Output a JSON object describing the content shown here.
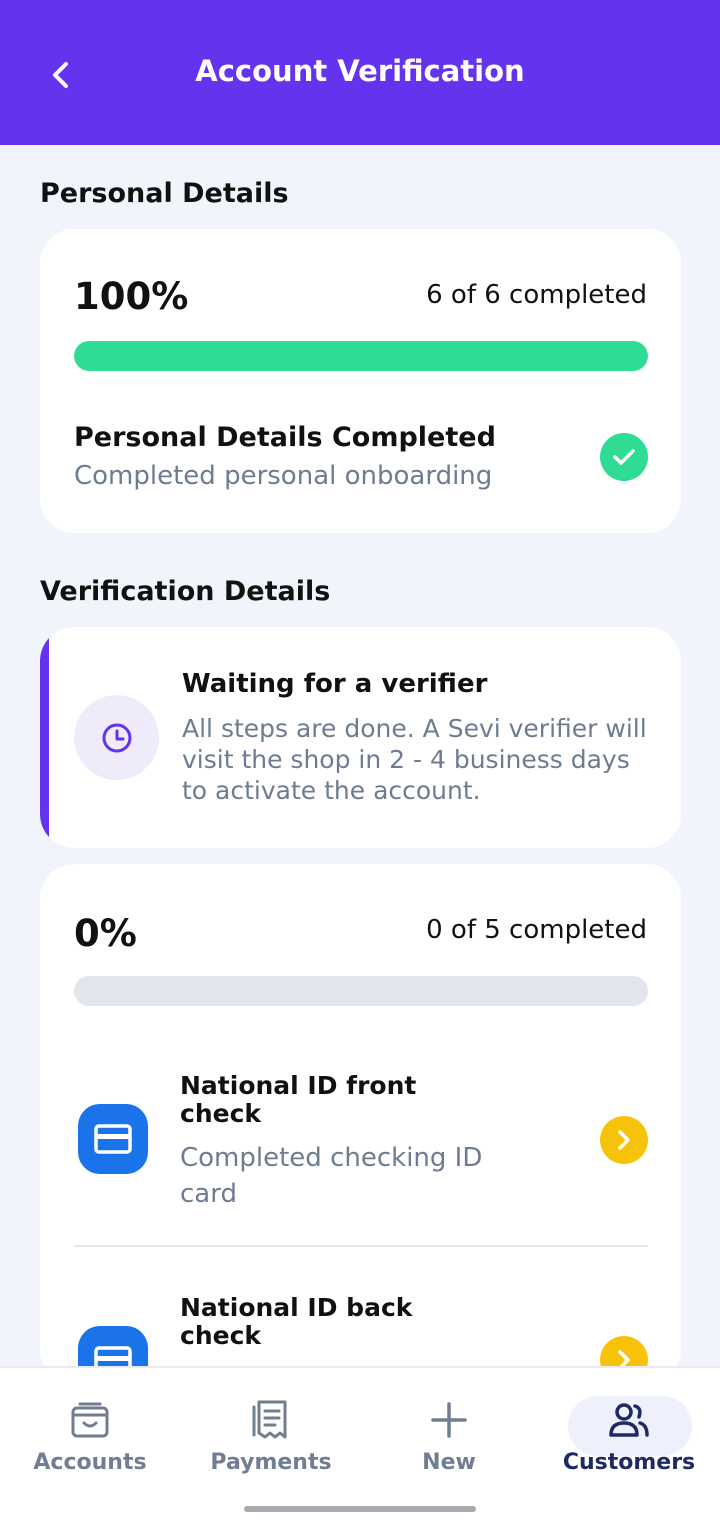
{
  "header": {
    "title": "Account Verification"
  },
  "personal": {
    "section_title": "Personal Details",
    "percent": "100%",
    "progress": 1.0,
    "count": "6 of 6 completed",
    "item_title": "Personal Details Completed",
    "item_subtitle": "Completed personal onboarding"
  },
  "verification": {
    "section_title": "Verification Details",
    "notice_title": "Waiting for a verifier",
    "notice_text": "All steps are done. A Sevi verifier will visit the shop in 2 - 4 business days to activate the account.",
    "percent": "0%",
    "progress": 0.0,
    "count": "0 of 5 completed",
    "steps": [
      {
        "title": "National ID front check",
        "subtitle": "Completed checking ID card"
      },
      {
        "title": "National ID back check",
        "subtitle": ""
      }
    ]
  },
  "nav": {
    "items": [
      {
        "label": "Accounts",
        "icon": "wallet-icon"
      },
      {
        "label": "Payments",
        "icon": "receipt-icon"
      },
      {
        "label": "New",
        "icon": "plus-icon"
      },
      {
        "label": "Customers",
        "icon": "users-icon"
      }
    ],
    "active": "Customers"
  },
  "colors": {
    "header": "#6433ee",
    "success": "#2fdc93",
    "accent_yellow": "#f7c30a",
    "step_blue": "#1a73e8",
    "muted_text": "#6d7c91"
  }
}
